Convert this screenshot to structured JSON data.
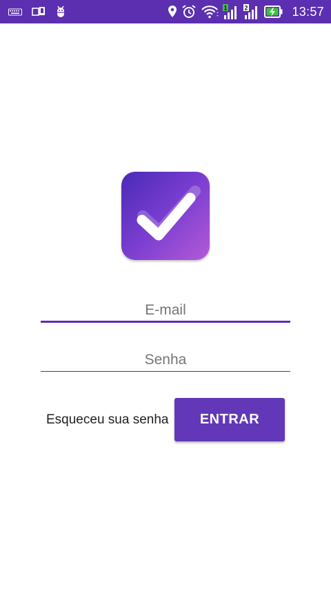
{
  "status_bar": {
    "time": "13:57",
    "background": "#5b2fb0",
    "left_icons": [
      "keyboard-icon",
      "screen-cast-icon",
      "android-debug-icon"
    ],
    "right_icons": [
      "location-icon",
      "alarm-icon",
      "wifi-icon",
      "signal-sim1-icon",
      "signal-sim2-icon",
      "battery-charging-icon"
    ],
    "sim1_label": "1",
    "sim2_label": "2"
  },
  "logo": {
    "icon": "checkmark-icon",
    "gradient": [
      "#4a2ab8",
      "#b45ad8"
    ]
  },
  "login": {
    "email_placeholder": "E-mail",
    "password_placeholder": "Senha",
    "forgot_label": "Esqueceu sua senha",
    "enter_label": "ENTRAR"
  },
  "colors": {
    "accent": "#5b2fb0",
    "button": "#6238b8"
  }
}
